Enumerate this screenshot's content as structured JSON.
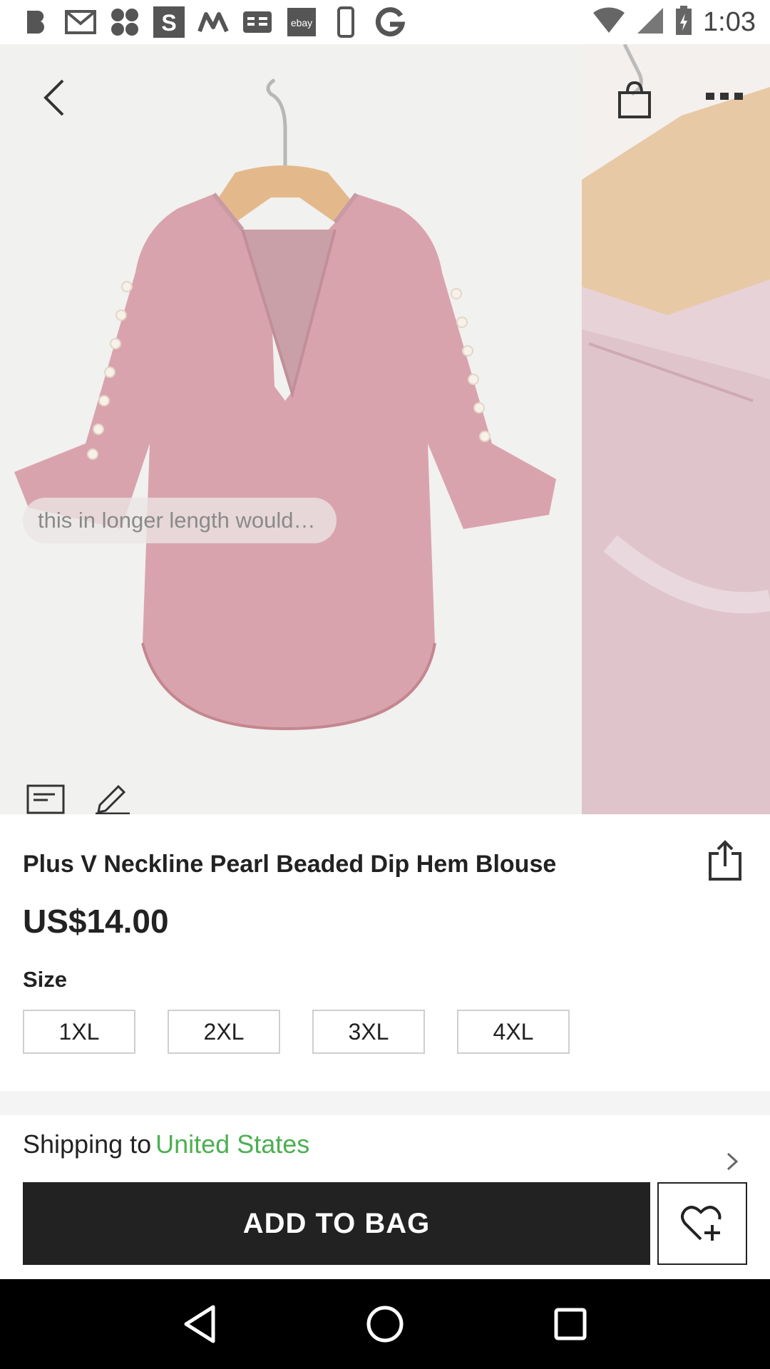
{
  "status_bar": {
    "time": "1:03",
    "notification_icons": [
      "bold-b-icon",
      "gmail-icon",
      "pinwheel-icon",
      "s-app-icon",
      "m-app-icon",
      "ge-app-icon",
      "ebay-icon",
      "phone-device-icon",
      "google-icon"
    ],
    "ebay_text": "ebay"
  },
  "gallery": {
    "comment_preview": "this in longer length would…",
    "product_color": "#d9a3ad"
  },
  "product": {
    "title": "Plus V Neckline Pearl Beaded Dip Hem Blouse",
    "price": "US$14.00",
    "size_label": "Size",
    "sizes": [
      "1XL",
      "2XL",
      "3XL",
      "4XL"
    ]
  },
  "shipping": {
    "prefix": "Shipping to",
    "country": "United States",
    "country_color": "#4caf50"
  },
  "actions": {
    "add_to_bag": "ADD TO BAG"
  }
}
